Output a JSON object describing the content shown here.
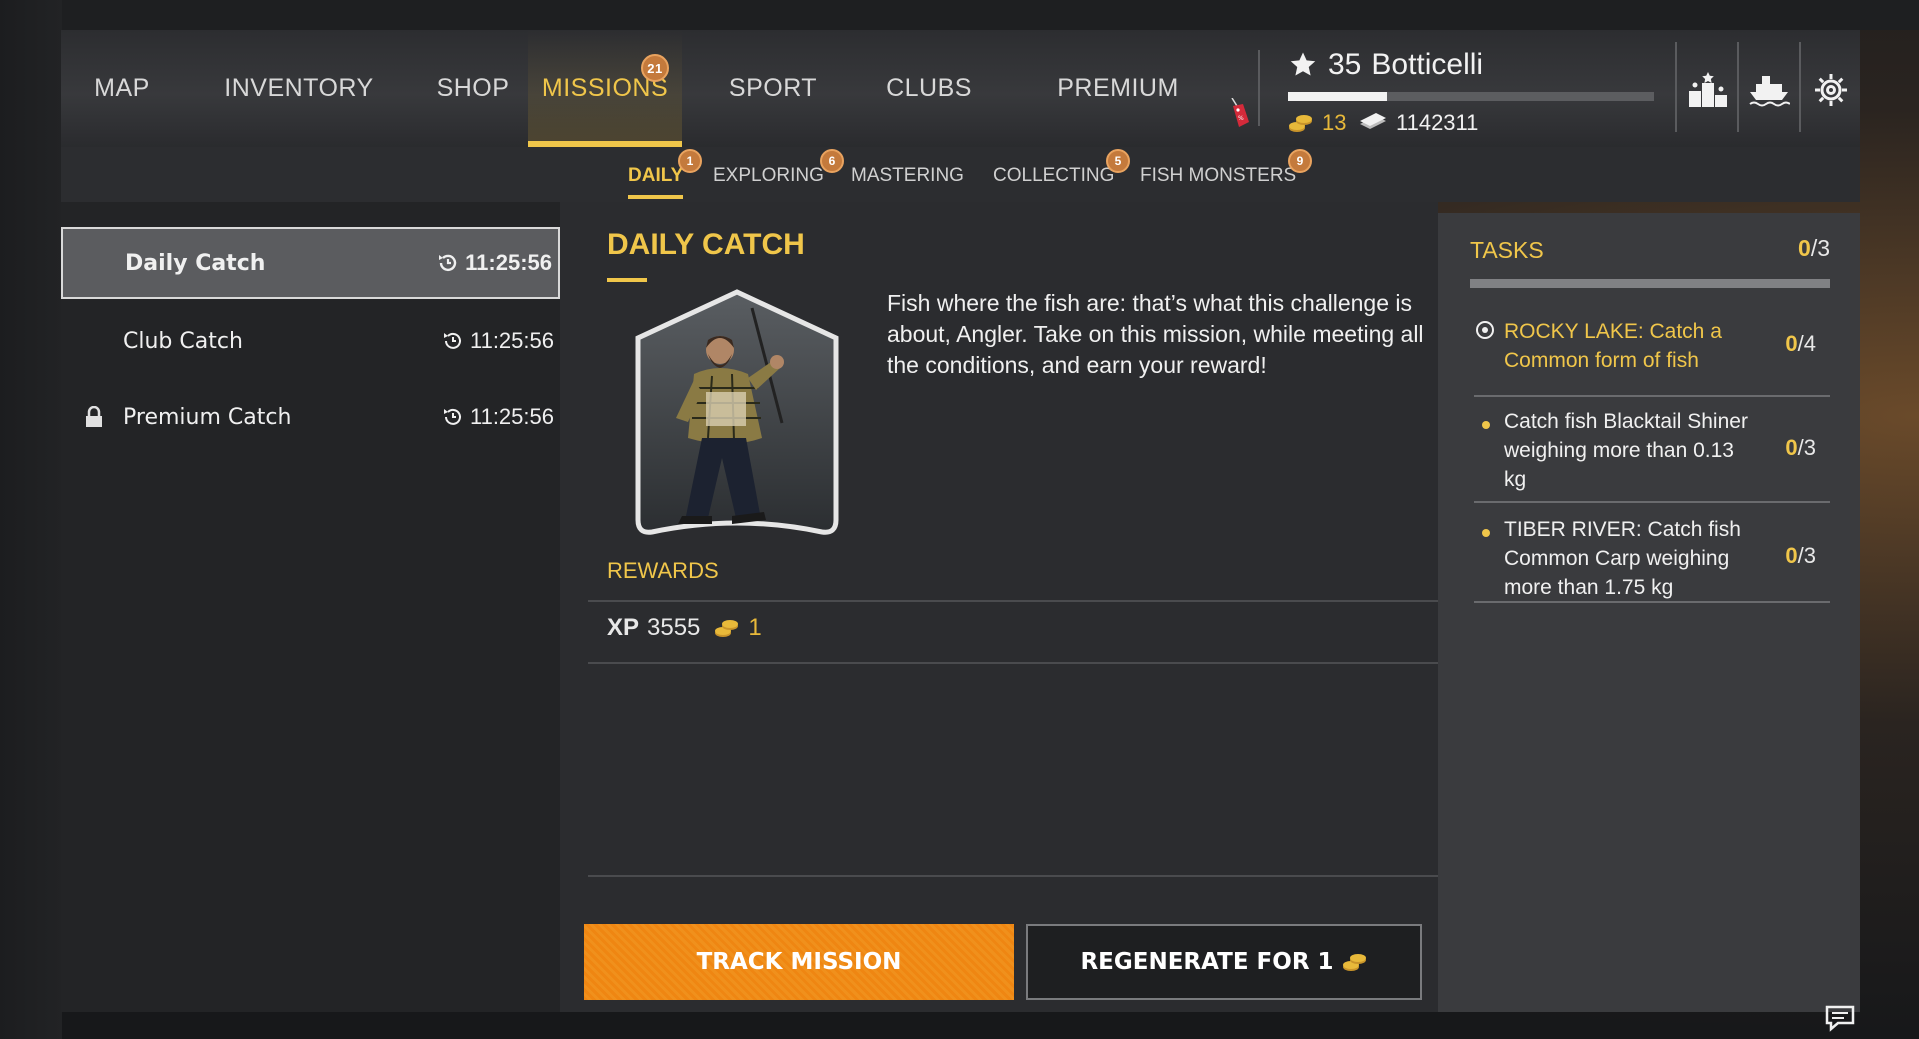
{
  "nav": {
    "items": [
      {
        "label": "MAP"
      },
      {
        "label": "INVENTORY"
      },
      {
        "label": "SHOP"
      },
      {
        "label": "MISSIONS",
        "badge": "21",
        "active": true
      },
      {
        "label": "SPORT"
      },
      {
        "label": "CLUBS"
      },
      {
        "label": "PREMIUM"
      }
    ]
  },
  "player": {
    "level": "35",
    "name": "Botticelli",
    "xp_progress": 0.27,
    "gold": "13",
    "silver": "1142311"
  },
  "subtabs": [
    {
      "label": "DAILY",
      "badge": "1",
      "active": true
    },
    {
      "label": "EXPLORING",
      "badge": "6"
    },
    {
      "label": "MASTERING",
      "badge": ""
    },
    {
      "label": "COLLECTING",
      "badge": "5"
    },
    {
      "label": "FISH MONSTERS",
      "badge": "9"
    }
  ],
  "missions": [
    {
      "label": "Daily Catch",
      "timer": "11:25:56",
      "selected": true
    },
    {
      "label": "Club Catch",
      "timer": "11:25:56"
    },
    {
      "label": "Premium Catch",
      "timer": "11:25:56",
      "locked": true
    }
  ],
  "detail": {
    "title": "DAILY CATCH",
    "description": "Fish where the fish are: that’s what this challenge is about, Angler. Take on this mission, while meeting all the conditions, and earn your reward!",
    "rewards_label": "REWARDS",
    "reward_xp_label": "XP",
    "reward_xp": "3555",
    "reward_gold": "1",
    "track_button": "TRACK MISSION",
    "regen_button": "REGENERATE FOR 1"
  },
  "tasks": {
    "title": "TASKS",
    "done": "0",
    "total": "/3",
    "items": [
      {
        "text": "ROCKY LAKE: Catch a Common form of fish",
        "done": "0",
        "total": "/4",
        "current": true
      },
      {
        "text": "Catch fish Blacktail Shiner weighing more than 0.13 kg",
        "done": "0",
        "total": "/3"
      },
      {
        "text": "TIBER RIVER: Catch fish Common Carp weighing more than 1.75 kg",
        "done": "0",
        "total": "/3"
      }
    ]
  },
  "icons": {
    "star": "star-icon",
    "gold": "gold-coins-icon",
    "silver": "silver-cash-icon",
    "leaderboard": "podium-icon",
    "boat": "boat-icon",
    "settings": "gear-icon",
    "timer": "timer-icon",
    "lock": "lock-icon",
    "chat": "chat-icon"
  },
  "colors": {
    "accent": "#f0c64a",
    "track_button": "#ef8612",
    "badge": "#c47a3c"
  }
}
